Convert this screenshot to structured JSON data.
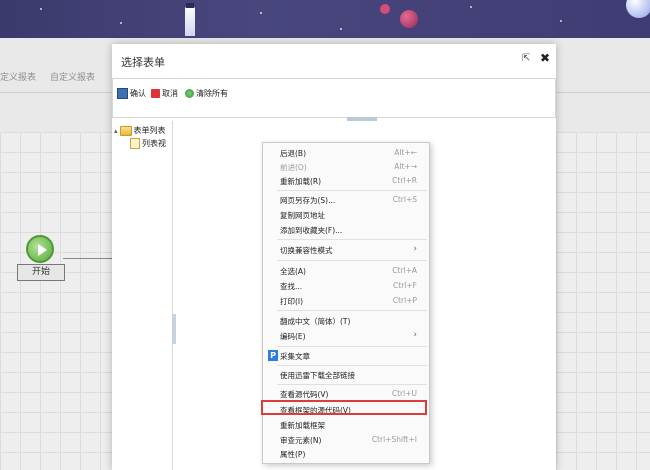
{
  "background": {
    "tabs": [
      "定义报表",
      "自定义报表"
    ],
    "start_node_label": "开始"
  },
  "dialog": {
    "title": "选择表单",
    "toolbar": {
      "confirm": "确认",
      "cancel": "取消",
      "clear_all": "清除所有"
    },
    "tree": {
      "root": "表单列表",
      "child": "列表视"
    }
  },
  "context_menu": {
    "items": [
      {
        "label": "后退(B)",
        "shortcut": "Alt+←"
      },
      {
        "label": "前进(O)",
        "shortcut": "Alt+→",
        "disabled": true
      },
      {
        "label": "重新加载(R)",
        "shortcut": "Ctrl+R"
      },
      {
        "label": "网页另存为(S)...",
        "shortcut": "Ctrl+S"
      },
      {
        "label": "复制网页地址",
        "shortcut": ""
      },
      {
        "label": "添加到收藏夹(F)...",
        "shortcut": ""
      },
      {
        "label": "切换兼容性模式",
        "submenu": true
      },
      {
        "label": "全选(A)",
        "shortcut": "Ctrl+A"
      },
      {
        "label": "查找...",
        "shortcut": "Ctrl+F"
      },
      {
        "label": "打印(I)",
        "shortcut": "Ctrl+P"
      },
      {
        "label": "翻成中文（简体）(T)",
        "shortcut": ""
      },
      {
        "label": "编码(E)",
        "submenu": true
      },
      {
        "label": "采集文章",
        "shortcut": ""
      },
      {
        "label": "使用迅雷下载全部链接",
        "shortcut": ""
      },
      {
        "label": "查看源代码(V)",
        "shortcut": "Ctrl+U"
      },
      {
        "label": "查看框架的源代码(V)",
        "shortcut": "",
        "highlighted": true
      },
      {
        "label": "重新加载框架",
        "shortcut": ""
      },
      {
        "label": "审查元素(N)",
        "shortcut": "Ctrl+Shift+I"
      },
      {
        "label": "属性(P)",
        "shortcut": ""
      }
    ],
    "highlight_color": "#e03b3b",
    "caiji_icon_letter": "P"
  }
}
